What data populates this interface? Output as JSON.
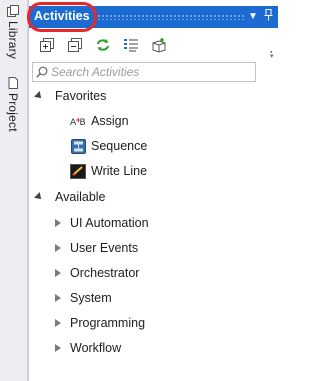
{
  "side_tabs": {
    "library": "Library",
    "project": "Project"
  },
  "panel": {
    "title": "Activities",
    "colors": {
      "title_bar": "#1c6bd3",
      "highlight_oval": "#e8272a"
    },
    "toolbar": {
      "icons": [
        "expand-all-icon",
        "collapse-all-icon",
        "refresh-icon",
        "show-list-icon",
        "add-package-icon"
      ]
    },
    "search": {
      "placeholder": "Search Activities"
    },
    "tree": {
      "favorites": {
        "label": "Favorites",
        "items": [
          {
            "label": "Assign",
            "icon": "assign-icon"
          },
          {
            "label": "Sequence",
            "icon": "sequence-icon"
          },
          {
            "label": "Write Line",
            "icon": "write-line-icon"
          }
        ]
      },
      "available": {
        "label": "Available",
        "items": [
          "UI Automation",
          "User Events",
          "Orchestrator",
          "System",
          "Programming",
          "Workflow"
        ]
      }
    }
  }
}
